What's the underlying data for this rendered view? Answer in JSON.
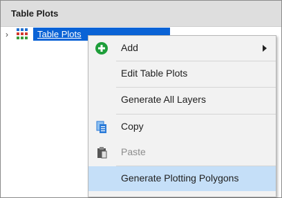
{
  "panel": {
    "title": "Table Plots"
  },
  "tree": {
    "node_label": "Table Plots",
    "expand_glyph": "›"
  },
  "context_menu": {
    "items": [
      {
        "label": "Add",
        "icon": "add-icon",
        "has_submenu": true
      },
      {
        "label": "Edit Table Plots"
      },
      {
        "label": "Generate All Layers"
      },
      {
        "label": "Copy",
        "icon": "copy-icon"
      },
      {
        "label": "Paste",
        "icon": "paste-icon",
        "disabled": true
      },
      {
        "label": "Generate Plotting Polygons",
        "highlighted": true
      }
    ]
  },
  "colors": {
    "selection": "#0a63d6",
    "highlight": "#c5dff8",
    "add_icon": "#1e9e3a",
    "copy_icon": "#2b7bd8"
  }
}
